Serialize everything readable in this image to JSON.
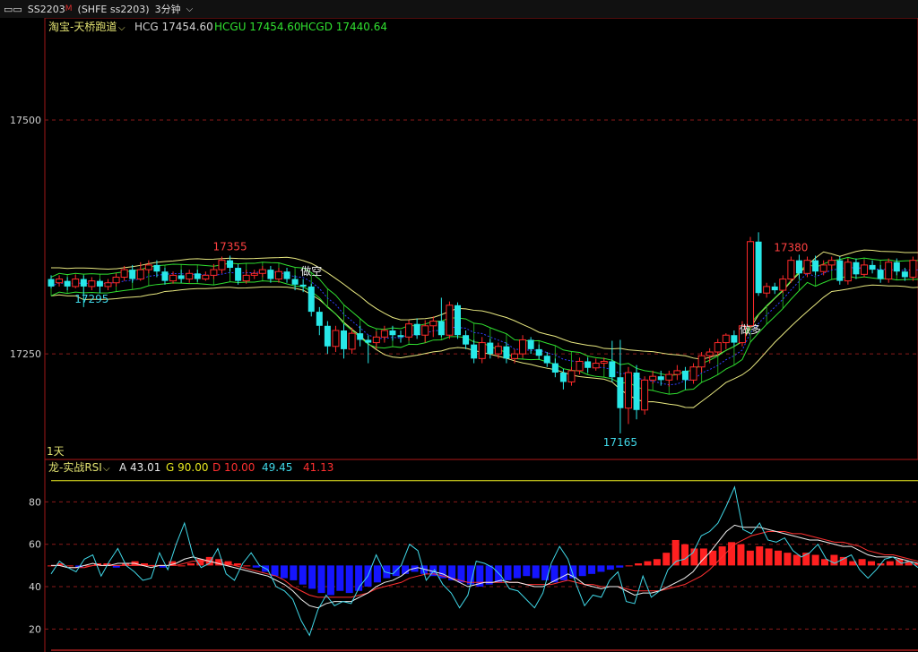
{
  "toolbar": {
    "symbol": "SS2203",
    "marker": "M",
    "exchange": "(SHFE ss2203)",
    "period": "3分钟"
  },
  "main": {
    "indicator": "淘宝-天桥跑道",
    "legend": [
      {
        "text": "HCG 17454.60",
        "color": "#d0d0d0"
      },
      {
        "text": "HCGU 17454.60",
        "color": "#30e030"
      },
      {
        "text": "HCGD 17440.64",
        "color": "#30e030"
      }
    ],
    "cycle": "1天",
    "price_ticks": [
      "17500",
      "17250"
    ],
    "signals": [
      {
        "label": "做空",
        "bar": 32,
        "color": "#f0f0f0"
      },
      {
        "label": "做多",
        "bar": 86,
        "color": "#f0f0f0"
      }
    ],
    "extremes": [
      {
        "label": "17355",
        "bar": 22,
        "color": "#ff4040"
      },
      {
        "label": "17295",
        "bar": 5,
        "color": "#40d8e8"
      },
      {
        "label": "17165",
        "bar": 70,
        "color": "#40d8e8"
      },
      {
        "label": "17380",
        "bar": 91,
        "color": "#ff4040"
      }
    ]
  },
  "rsi": {
    "indicator": "龙-实战RSI",
    "legend": [
      {
        "text": "A 43.01",
        "color": "#e8e8e8"
      },
      {
        "text": "G 90.00",
        "color": "#e8e820"
      },
      {
        "text": "D 10.00",
        "color": "#ff3030"
      },
      {
        "text": "49.45",
        "color": "#40d8e8"
      },
      {
        "text": "41.13",
        "color": "#ff3030"
      }
    ],
    "ticks": [
      "80",
      "60",
      "40",
      "20"
    ]
  },
  "chart_data": {
    "type": "candlestick",
    "price_axis": {
      "ticks": [
        17500,
        17250
      ],
      "range": [
        17140,
        17590
      ]
    },
    "candles": [
      [
        17330,
        17322,
        17334,
        17320
      ],
      [
        17326,
        17330,
        17334,
        17322
      ],
      [
        17328,
        17322,
        17332,
        17318
      ],
      [
        17322,
        17330,
        17335,
        17320
      ],
      [
        17330,
        17322,
        17334,
        17300
      ],
      [
        17322,
        17328,
        17332,
        17318
      ],
      [
        17328,
        17322,
        17330,
        17315
      ],
      [
        17322,
        17326,
        17330,
        17318
      ],
      [
        17326,
        17332,
        17336,
        17322
      ],
      [
        17332,
        17340,
        17344,
        17328
      ],
      [
        17340,
        17330,
        17345,
        17326
      ],
      [
        17330,
        17340,
        17348,
        17328
      ],
      [
        17340,
        17345,
        17350,
        17336
      ],
      [
        17345,
        17338,
        17350,
        17332
      ],
      [
        17338,
        17328,
        17342,
        17324
      ],
      [
        17328,
        17334,
        17338,
        17325
      ],
      [
        17334,
        17330,
        17340,
        17326
      ],
      [
        17330,
        17336,
        17340,
        17326
      ],
      [
        17336,
        17330,
        17340,
        17327
      ],
      [
        17330,
        17334,
        17338,
        17328
      ],
      [
        17334,
        17340,
        17346,
        17330
      ],
      [
        17340,
        17350,
        17354,
        17336
      ],
      [
        17350,
        17342,
        17355,
        17338
      ],
      [
        17342,
        17328,
        17346,
        17324
      ],
      [
        17328,
        17334,
        17340,
        17325
      ],
      [
        17334,
        17336,
        17340,
        17330
      ],
      [
        17336,
        17340,
        17344,
        17332
      ],
      [
        17340,
        17330,
        17344,
        17326
      ],
      [
        17330,
        17338,
        17342,
        17326
      ],
      [
        17338,
        17330,
        17342,
        17326
      ],
      [
        17330,
        17324,
        17334,
        17318
      ],
      [
        17324,
        17322,
        17330,
        17316
      ],
      [
        17322,
        17295,
        17325,
        17290
      ],
      [
        17295,
        17280,
        17300,
        17270
      ],
      [
        17280,
        17258,
        17285,
        17250
      ],
      [
        17258,
        17275,
        17280,
        17252
      ],
      [
        17275,
        17255,
        17282,
        17245
      ],
      [
        17255,
        17272,
        17278,
        17250
      ],
      [
        17272,
        17265,
        17280,
        17258
      ],
      [
        17265,
        17262,
        17270,
        17240
      ],
      [
        17262,
        17268,
        17274,
        17255
      ],
      [
        17268,
        17275,
        17280,
        17262
      ],
      [
        17275,
        17270,
        17280,
        17264
      ],
      [
        17270,
        17268,
        17275,
        17262
      ],
      [
        17268,
        17282,
        17286,
        17264
      ],
      [
        17282,
        17270,
        17288,
        17266
      ],
      [
        17270,
        17280,
        17286,
        17262
      ],
      [
        17280,
        17285,
        17290,
        17268
      ],
      [
        17285,
        17270,
        17310,
        17268
      ],
      [
        17270,
        17302,
        17306,
        17266
      ],
      [
        17302,
        17270,
        17305,
        17266
      ],
      [
        17270,
        17260,
        17275,
        17255
      ],
      [
        17260,
        17245,
        17265,
        17240
      ],
      [
        17245,
        17262,
        17268,
        17240
      ],
      [
        17262,
        17250,
        17266,
        17245
      ],
      [
        17250,
        17258,
        17262,
        17245
      ],
      [
        17258,
        17245,
        17262,
        17240
      ],
      [
        17245,
        17250,
        17255,
        17240
      ],
      [
        17250,
        17265,
        17270,
        17246
      ],
      [
        17265,
        17255,
        17268,
        17250
      ],
      [
        17255,
        17248,
        17260,
        17244
      ],
      [
        17248,
        17240,
        17252,
        17236
      ],
      [
        17240,
        17230,
        17245,
        17225
      ],
      [
        17230,
        17220,
        17234,
        17212
      ],
      [
        17220,
        17232,
        17236,
        17216
      ],
      [
        17232,
        17242,
        17246,
        17228
      ],
      [
        17242,
        17235,
        17246,
        17230
      ],
      [
        17235,
        17240,
        17245,
        17232
      ],
      [
        17240,
        17242,
        17246,
        17236
      ],
      [
        17242,
        17225,
        17264,
        17220
      ],
      [
        17225,
        17192,
        17265,
        17165
      ],
      [
        17192,
        17230,
        17236,
        17175
      ],
      [
        17230,
        17190,
        17238,
        17180
      ],
      [
        17190,
        17222,
        17226,
        17185
      ],
      [
        17222,
        17226,
        17232,
        17218
      ],
      [
        17226,
        17222,
        17232,
        17216
      ],
      [
        17222,
        17228,
        17232,
        17215
      ],
      [
        17228,
        17232,
        17238,
        17222
      ],
      [
        17232,
        17222,
        17236,
        17212
      ],
      [
        17222,
        17236,
        17240,
        17218
      ],
      [
        17236,
        17248,
        17252,
        17230
      ],
      [
        17248,
        17252,
        17256,
        17240
      ],
      [
        17252,
        17262,
        17266,
        17248
      ],
      [
        17262,
        17270,
        17272,
        17255
      ],
      [
        17270,
        17262,
        17275,
        17258
      ],
      [
        17262,
        17280,
        17285,
        17258
      ],
      [
        17280,
        17370,
        17375,
        17278
      ],
      [
        17370,
        17315,
        17380,
        17312
      ],
      [
        17315,
        17322,
        17326,
        17310
      ],
      [
        17322,
        17318,
        17326,
        17314
      ],
      [
        17318,
        17330,
        17334,
        17315
      ],
      [
        17330,
        17350,
        17354,
        17326
      ],
      [
        17350,
        17336,
        17356,
        17330
      ],
      [
        17336,
        17350,
        17354,
        17332
      ],
      [
        17350,
        17338,
        17355,
        17334
      ],
      [
        17338,
        17345,
        17350,
        17334
      ],
      [
        17345,
        17350,
        17354,
        17340
      ],
      [
        17350,
        17328,
        17354,
        17324
      ],
      [
        17328,
        17348,
        17352,
        17324
      ],
      [
        17348,
        17335,
        17352,
        17330
      ],
      [
        17335,
        17345,
        17350,
        17332
      ],
      [
        17345,
        17340,
        17350,
        17336
      ],
      [
        17340,
        17330,
        17345,
        17326
      ],
      [
        17330,
        17348,
        17352,
        17326
      ],
      [
        17348,
        17338,
        17352,
        17334
      ],
      [
        17338,
        17332,
        17342,
        17328
      ],
      [
        17332,
        17350,
        17354,
        17328
      ],
      [
        17350,
        17335,
        17354,
        17330
      ]
    ],
    "rsi_axis": {
      "ticks": [
        80,
        60,
        40,
        20
      ],
      "range": [
        10,
        92
      ]
    },
    "rsi_cyan": [
      46,
      52,
      49,
      47,
      53,
      55,
      45,
      52,
      58,
      50,
      47,
      43,
      44,
      56,
      48,
      60,
      70,
      55,
      49,
      51,
      58,
      46,
      43,
      51,
      56,
      50,
      48,
      40,
      38,
      34,
      24,
      17,
      29,
      36,
      31,
      33,
      32,
      40,
      45,
      55,
      47,
      46,
      50,
      60,
      57,
      43,
      48,
      41,
      37,
      30,
      36,
      52,
      51,
      49,
      45,
      39,
      38,
      34,
      30,
      37,
      51,
      59,
      53,
      41,
      31,
      36,
      35,
      43,
      47,
      33,
      32,
      45,
      35,
      38,
      48,
      52,
      53,
      56,
      64,
      66,
      70,
      78,
      87,
      67,
      65,
      70,
      62,
      61,
      63,
      57,
      54,
      56,
      60,
      53,
      51,
      53,
      55,
      48,
      44,
      48,
      53,
      54,
      51,
      52,
      49
    ],
    "rsi_white": [
      50,
      50,
      49,
      49,
      50,
      51,
      50,
      50,
      51,
      51,
      51,
      50,
      49,
      50,
      50,
      51,
      53,
      54,
      53,
      52,
      51,
      50,
      49,
      48,
      47,
      46,
      45,
      43,
      41,
      38,
      34,
      31,
      30,
      32,
      33,
      33,
      33,
      35,
      37,
      40,
      42,
      43,
      45,
      48,
      49,
      48,
      47,
      46,
      44,
      42,
      40,
      41,
      42,
      42,
      43,
      42,
      42,
      41,
      40,
      40,
      42,
      44,
      46,
      44,
      41,
      40,
      39,
      40,
      40,
      38,
      36,
      37,
      37,
      38,
      40,
      42,
      44,
      47,
      52,
      56,
      61,
      66,
      69,
      68,
      68,
      68,
      67,
      66,
      65,
      64,
      63,
      62,
      62,
      61,
      60,
      59,
      59,
      57,
      55,
      54,
      54,
      54,
      53,
      52,
      51
    ],
    "rsi_red": [
      50,
      50,
      49,
      49,
      49,
      50,
      50,
      50,
      50,
      50,
      50,
      50,
      50,
      50,
      50,
      50,
      51,
      52,
      52,
      52,
      51,
      51,
      50,
      49,
      48,
      47,
      46,
      45,
      43,
      40,
      38,
      36,
      35,
      35,
      35,
      35,
      35,
      36,
      37,
      39,
      40,
      41,
      42,
      44,
      45,
      46,
      46,
      45,
      44,
      43,
      42,
      42,
      42,
      42,
      42,
      42,
      42,
      41,
      41,
      41,
      41,
      42,
      43,
      42,
      41,
      41,
      40,
      40,
      40,
      39,
      38,
      38,
      38,
      38,
      39,
      40,
      41,
      43,
      45,
      48,
      52,
      56,
      60,
      62,
      64,
      65,
      66,
      66,
      66,
      65,
      65,
      64,
      63,
      62,
      61,
      61,
      60,
      59,
      57,
      56,
      55,
      55,
      54,
      53,
      52
    ],
    "rsi_bars": [
      50,
      51,
      50,
      49,
      50,
      51,
      51,
      49,
      51,
      52,
      51,
      50,
      49,
      52,
      50,
      51,
      53,
      54,
      53,
      52,
      51,
      50,
      49,
      47,
      45,
      44,
      43,
      41,
      39,
      37,
      36,
      38,
      37,
      38,
      40,
      42,
      44,
      45,
      46,
      47,
      46,
      45,
      44,
      43,
      42,
      41,
      40,
      41,
      42,
      43,
      44,
      45,
      44,
      43,
      42,
      43,
      44,
      45,
      46,
      47,
      48,
      49,
      50,
      51,
      52,
      53,
      56,
      62,
      60,
      58,
      58,
      57,
      59,
      61,
      60,
      57,
      59,
      58,
      57,
      56,
      55,
      56,
      55,
      53,
      55,
      54,
      52,
      53,
      52,
      51,
      52,
      53,
      52,
      51
    ]
  }
}
